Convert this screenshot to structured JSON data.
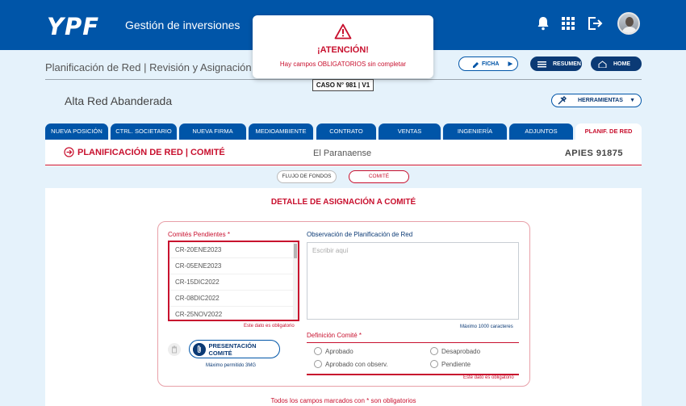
{
  "header": {
    "logo": "YPF",
    "app_title": "Gestión de inversiones",
    "icons": [
      "bell-icon",
      "apps-grid-icon",
      "logout-icon"
    ]
  },
  "breadcrumb": "Planificación de Red | Revisión y Asignación a Comité",
  "top_buttons": {
    "ficha": "FICHA",
    "resumen": "RESUMEN",
    "home": "HOME"
  },
  "caso": "CASO N° 981 | V1",
  "alert": {
    "title": "¡ATENCIÓN!",
    "message": "Hay campos OBLIGATORIOS sin completar"
  },
  "page_title": "Alta Red Abanderada",
  "herramientas": "HERRAMIENTAS",
  "tabs": [
    "NUEVA POSICIÓN",
    "CTRL. SOCIETARIO",
    "NUEVA FIRMA",
    "MEDIOAMBIENTE",
    "CONTRATO",
    "VENTAS",
    "INGENIERÍA",
    "ADJUNTOS",
    "PLANIF. DE RED"
  ],
  "section": {
    "title": "PLANIFICACIÓN DE RED | COMITÉ",
    "station": "El Paranaense",
    "apies": "APIES  91875"
  },
  "subtabs": [
    "FLUJO DE FONDOS",
    "COMITÉ"
  ],
  "detail_title": "DETALLE DE ASIGNACIÓN A COMITÉ",
  "form": {
    "comites_label": "Comités Pendientes *",
    "comites": [
      "CR-20ENE2023",
      "CR-05ENE2023",
      "CR-15DIC2022",
      "CR-08DIC2022",
      "CR-25NOV2022"
    ],
    "required_msg": "Este dato es obligatorio",
    "observacion_label": "Observación de Planificación de Red",
    "observacion_placeholder": "Escribir aquí",
    "max_chars": "Máximo 1000 caracteres",
    "presentacion_button": "PRESENTACIÓN COMITÉ",
    "max_size": "Máximo permitido 3MG",
    "definicion_label": "Definición Comité *",
    "options": [
      "Aprobado",
      "Desaprobado",
      "Aprobado con observ.",
      "Pendiente"
    ],
    "definicion_required": "Este dato es obligatorio"
  },
  "footnote": "Todos los campos marcados con * son obligatorios",
  "colors": {
    "brand_blue": "#0055a8",
    "dark_blue": "#0b3a75",
    "alert_red": "#c8102e",
    "page_bg": "#e5f2fb"
  }
}
